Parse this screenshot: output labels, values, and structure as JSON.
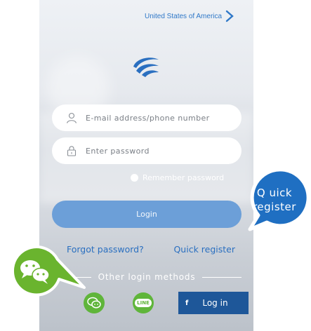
{
  "header": {
    "country": "United States of America"
  },
  "form": {
    "email_placeholder": "E-mail address/phone number",
    "password_placeholder": "Enter password",
    "remember_label": "Remember password",
    "login_label": "Login"
  },
  "links": {
    "forgot": "Forgot password?",
    "register": "Quick register"
  },
  "social": {
    "heading": "Other login methods",
    "line_icon_text": "LINE",
    "facebook_glyph": "f",
    "facebook_label": "Log in"
  },
  "callouts": {
    "quick_register_line1": "Q uick",
    "quick_register_line2": "register"
  },
  "colors": {
    "accent": "#2f78c8",
    "login_button": "#6c9fd8",
    "social_green": "#5fb53a",
    "facebook": "#1e5799",
    "callout_blue": "#1f6fc2"
  }
}
